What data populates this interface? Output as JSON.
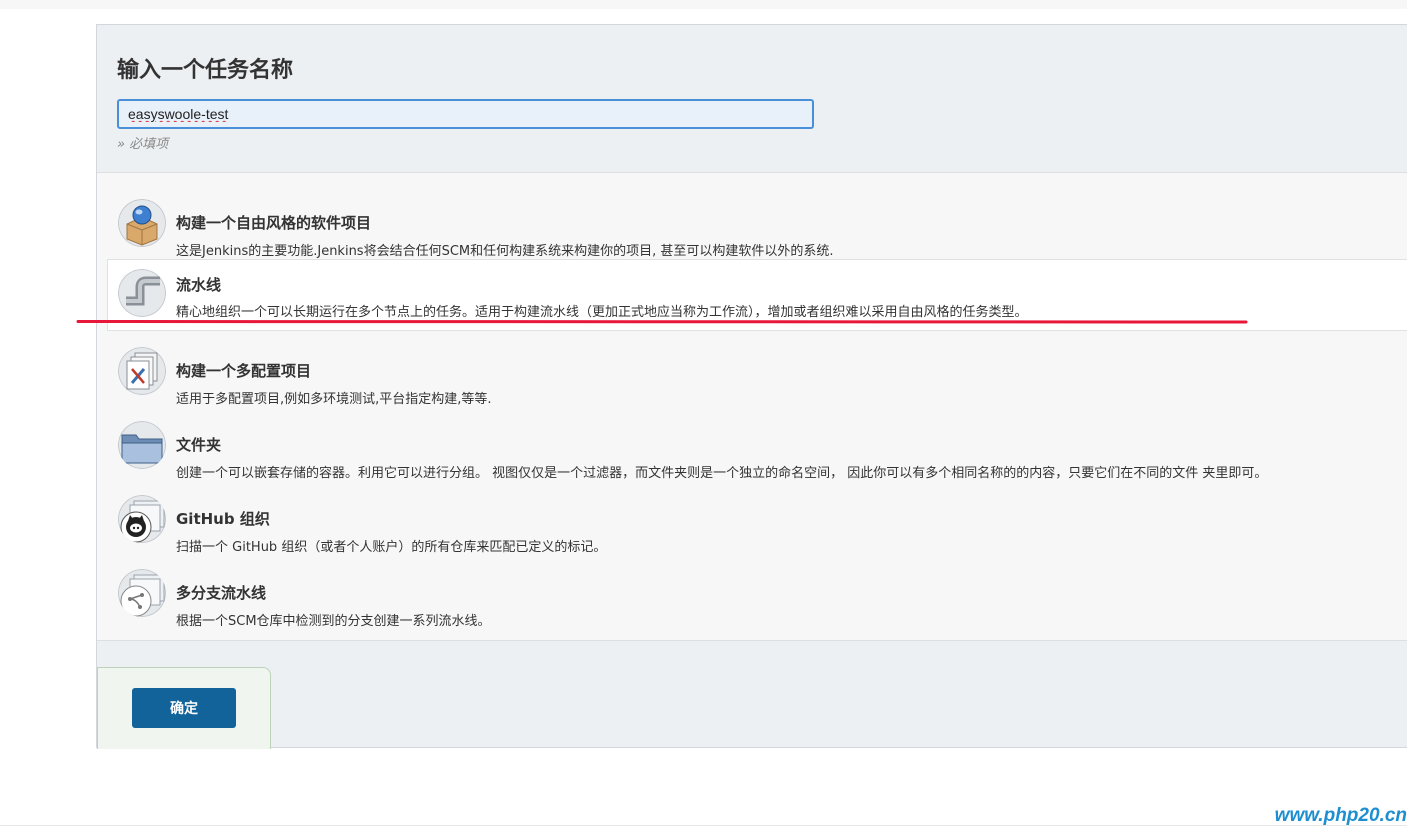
{
  "form": {
    "title": "输入一个任务名称",
    "name_value": "easyswoole-test",
    "required_note": "» 必填项"
  },
  "job_types": [
    {
      "label": "构建一个自由风格的软件项目",
      "desc": "这是Jenkins的主要功能.Jenkins将会结合任何SCM和任何构建系统来构建你的项目, 甚至可以构建软件以外的系统.",
      "icon": "freestyle-project-icon"
    },
    {
      "label": "流水线",
      "desc": "精心地组织一个可以长期运行在多个节点上的任务。适用于构建流水线（更加正式地应当称为工作流），增加或者组织难以采用自由风格的任务类型。",
      "icon": "pipeline-icon"
    },
    {
      "label": "构建一个多配置项目",
      "desc": "适用于多配置项目,例如多环境测试,平台指定构建,等等.",
      "icon": "multi-config-icon"
    },
    {
      "label": "文件夹",
      "desc": "创建一个可以嵌套存储的容器。利用它可以进行分组。 视图仅仅是一个过滤器，而文件夹则是一个独立的命名空间， 因此你可以有多个相同名称的的内容，只要它们在不同的文件 夹里即可。",
      "icon": "folder-icon"
    },
    {
      "label": "GitHub 组织",
      "desc": "扫描一个 GitHub 组织（或者个人账户）的所有仓库来匹配已定义的标记。",
      "icon": "github-icon"
    },
    {
      "label": "多分支流水线",
      "desc": "根据一个SCM仓库中检测到的分支创建一系列流水线。",
      "icon": "branch-icon"
    }
  ],
  "selected_index": 1,
  "actions": {
    "ok_label": "确定"
  },
  "watermark": "www.php20.cn",
  "colors": {
    "primary_button": "#13639b",
    "annotation": "#e8173a",
    "input_focus": "#4a90d9"
  }
}
